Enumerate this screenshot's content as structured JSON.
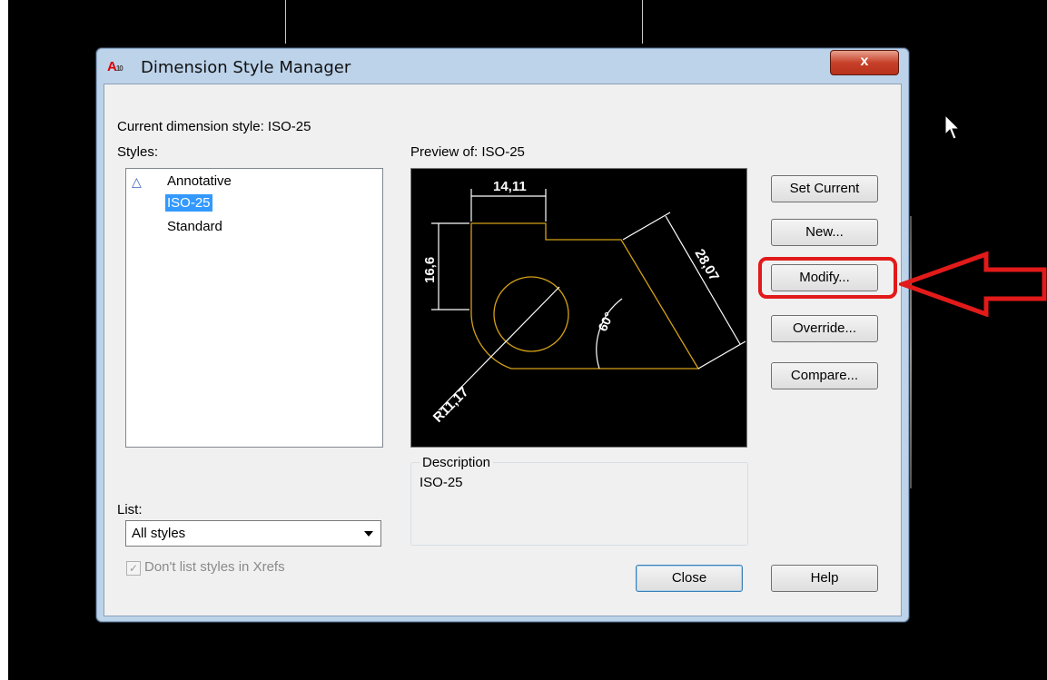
{
  "dialog": {
    "title": "Dimension Style Manager",
    "close_glyph": "x",
    "app_icon_letter": "A",
    "app_icon_num": "10",
    "current_style_label": "Current dimension style: ISO-25",
    "styles_label": "Styles:",
    "styles": [
      "Annotative",
      "ISO-25",
      "Standard"
    ],
    "selected_style": "ISO-25",
    "preview_label": "Preview of: ISO-25",
    "list_label": "List:",
    "list_value": "All styles",
    "xref_checkbox_label": "Don't list styles in Xrefs",
    "xref_checked": true,
    "description_label": "Description",
    "description_value": "ISO-25",
    "buttons": {
      "set_current": "Set Current",
      "new": "New...",
      "modify": "Modify...",
      "override": "Override...",
      "compare": "Compare...",
      "close": "Close",
      "help": "Help"
    },
    "preview_dims": {
      "top": "14,11",
      "left": "16,6",
      "diag": "28,07",
      "angle": "60°",
      "radius": "R11,17"
    }
  },
  "colors": {
    "highlight": "#e21a1a",
    "preview_geometry": "#d4a017",
    "selection": "#3399ff"
  }
}
